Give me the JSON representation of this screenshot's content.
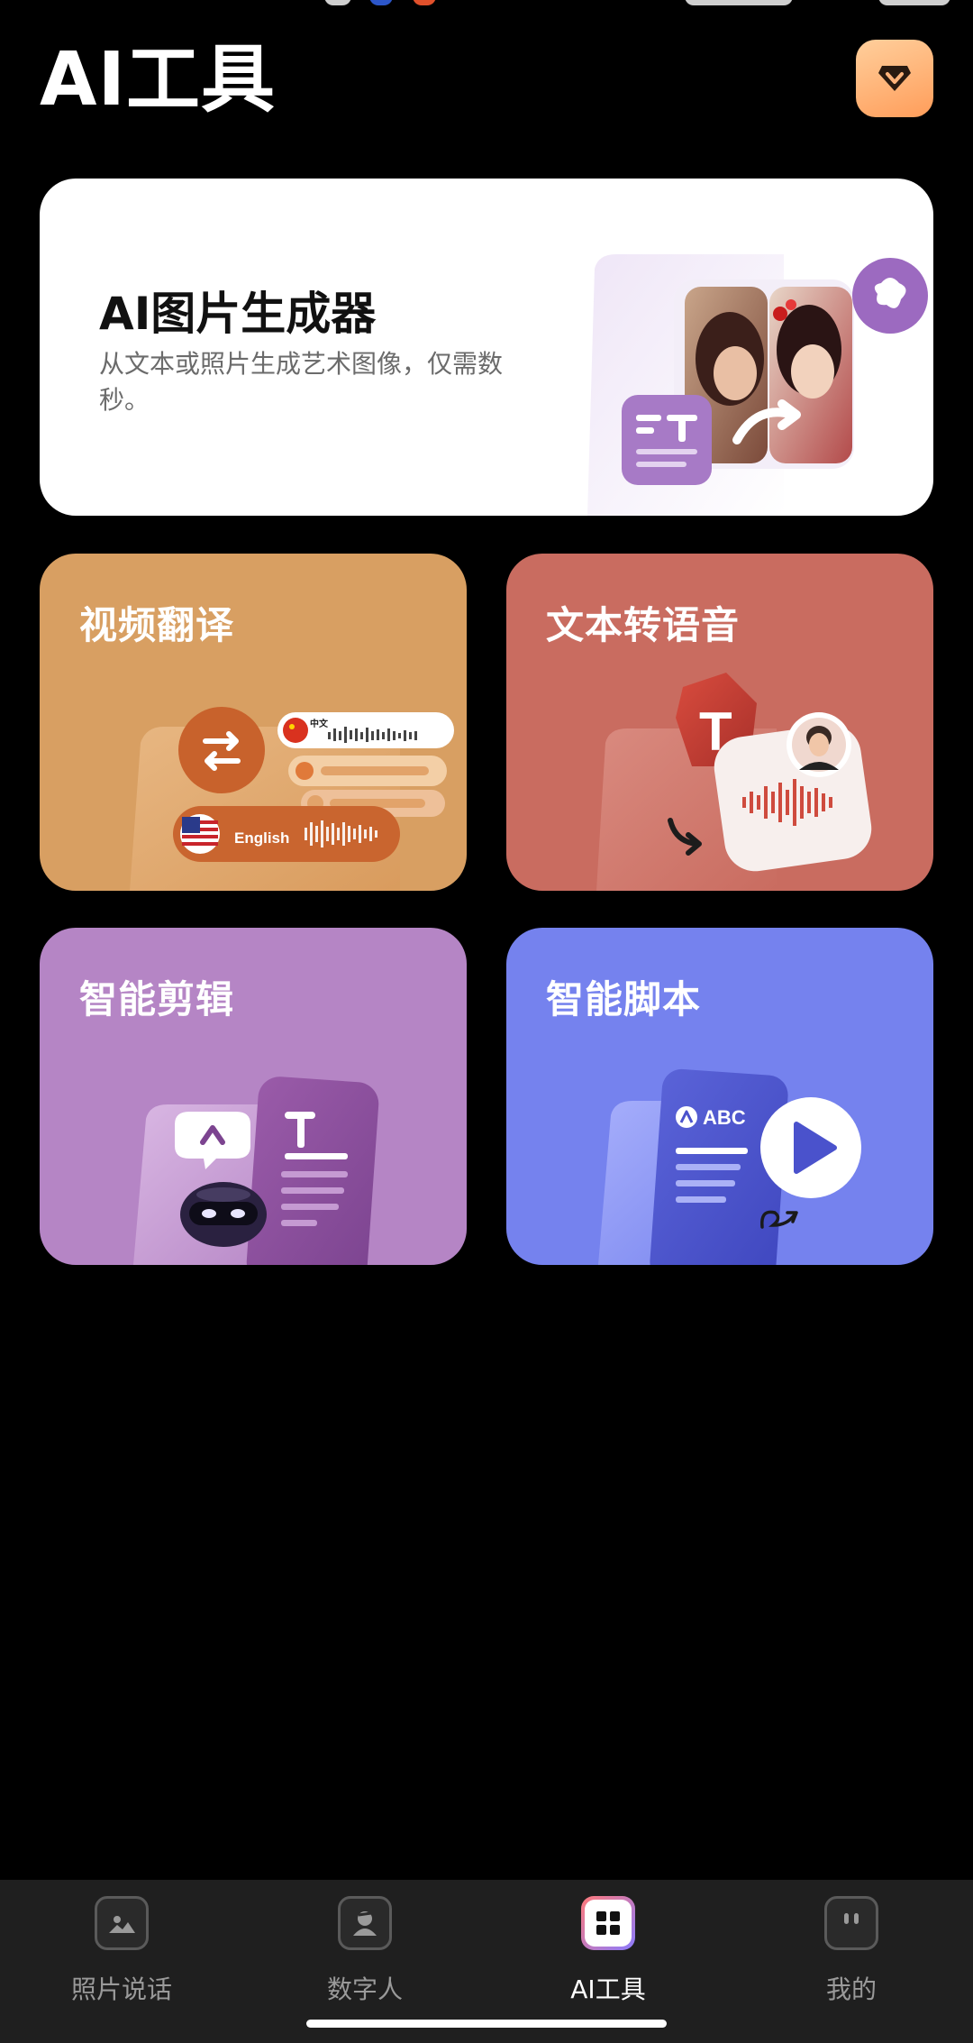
{
  "colors": {
    "background": "#000000",
    "premium_gradient": [
      "#ffcf9c",
      "#ff9d5a"
    ],
    "video_tile": "#d89f62",
    "tts_tile": "#c96c60",
    "edit_tile": "#b585c5",
    "script_tile": "#7582ee",
    "tabbar": "#1f1f1f"
  },
  "header": {
    "title": "AI工具",
    "premium_icon": "diamond-icon"
  },
  "hero": {
    "title": "AI图片生成器",
    "description": "从文本或照片生成艺术图像，仅需数秒。"
  },
  "tiles": {
    "video_translate": {
      "title": "视频翻译",
      "chip_chinese": "中文",
      "chip_english": "English"
    },
    "text_to_speech": {
      "title": "文本转语音",
      "letter": "T"
    },
    "smart_edit": {
      "title": "智能剪辑",
      "letter": "T"
    },
    "smart_script": {
      "title": "智能脚本",
      "doc_label": "ABC"
    }
  },
  "tabbar": {
    "tabs": [
      {
        "label": "照片说话",
        "icon": "photo-icon"
      },
      {
        "label": "数字人",
        "icon": "digital-human-icon"
      },
      {
        "label": "AI工具",
        "icon": "grid-icon",
        "active": true
      },
      {
        "label": "我的",
        "icon": "profile-icon"
      }
    ]
  }
}
